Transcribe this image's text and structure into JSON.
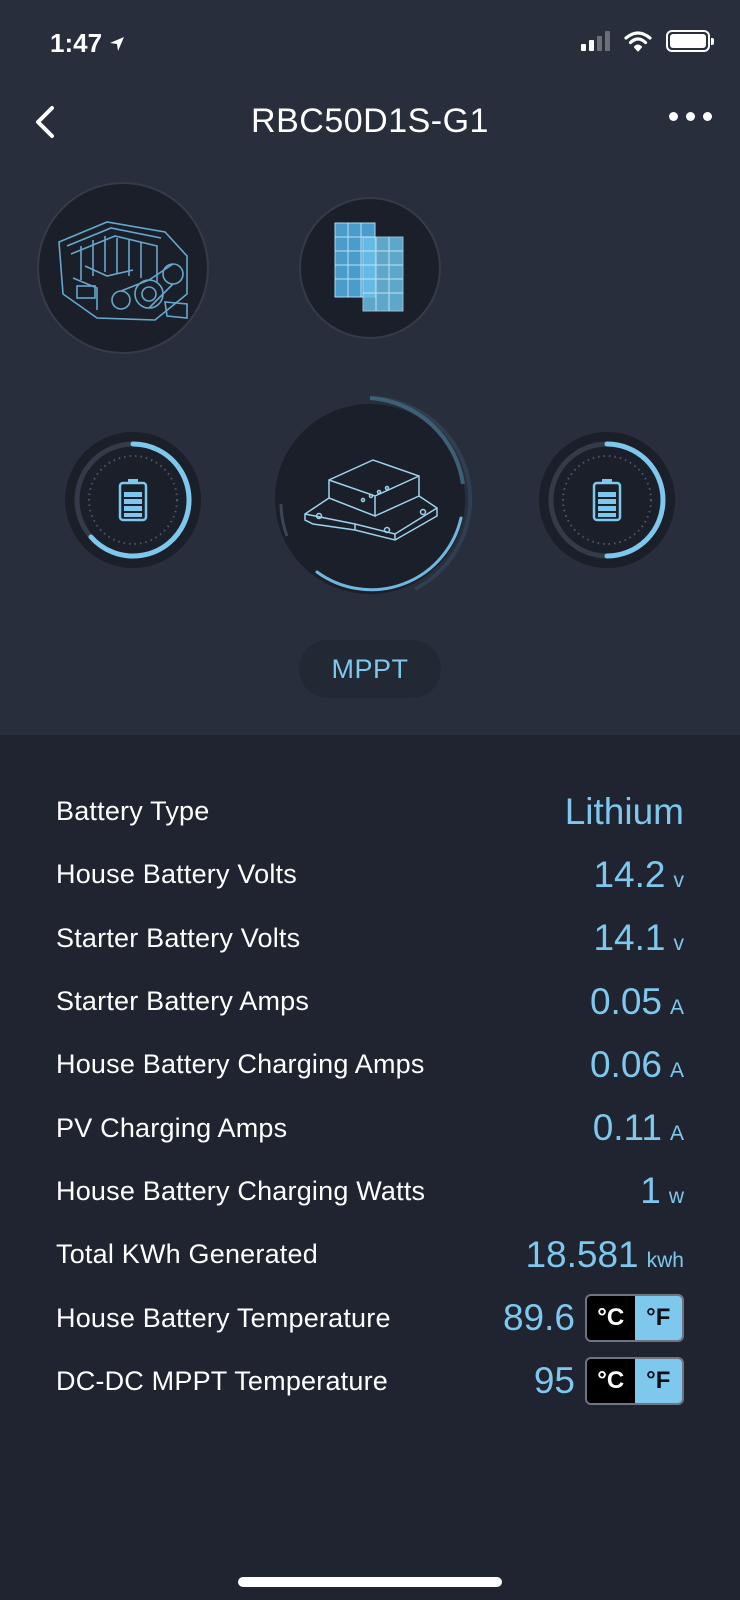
{
  "status_bar": {
    "time": "1:47"
  },
  "nav": {
    "title": "RBC50D1S-G1"
  },
  "mode": {
    "label": "MPPT"
  },
  "info_rows": [
    {
      "label": "Battery Type",
      "value": "Lithium",
      "unit": ""
    },
    {
      "label": "House Battery Volts",
      "value": "14.2",
      "unit": "v"
    },
    {
      "label": "Starter Battery Volts",
      "value": "14.1",
      "unit": "v"
    },
    {
      "label": "Starter Battery Amps",
      "value": "0.05",
      "unit": "A"
    },
    {
      "label": "House Battery Charging Amps",
      "value": "0.06",
      "unit": "A"
    },
    {
      "label": "PV Charging Amps",
      "value": "0.11",
      "unit": "A"
    },
    {
      "label": "House Battery Charging Watts",
      "value": "1",
      "unit": "w"
    },
    {
      "label": "Total KWh Generated",
      "value": "18.581",
      "unit": "kwh"
    },
    {
      "label": "House Battery Temperature",
      "value": "89.6",
      "unit_c": "°C",
      "unit_f": "°F",
      "selected_unit": "°F"
    },
    {
      "label": "DC-DC MPPT Temperature",
      "value": "95",
      "unit_c": "°C",
      "unit_f": "°F",
      "selected_unit": "°F"
    }
  ],
  "colors": {
    "accent": "#7ec8ee",
    "background": "#1f2430",
    "panel": "#282e3b"
  }
}
